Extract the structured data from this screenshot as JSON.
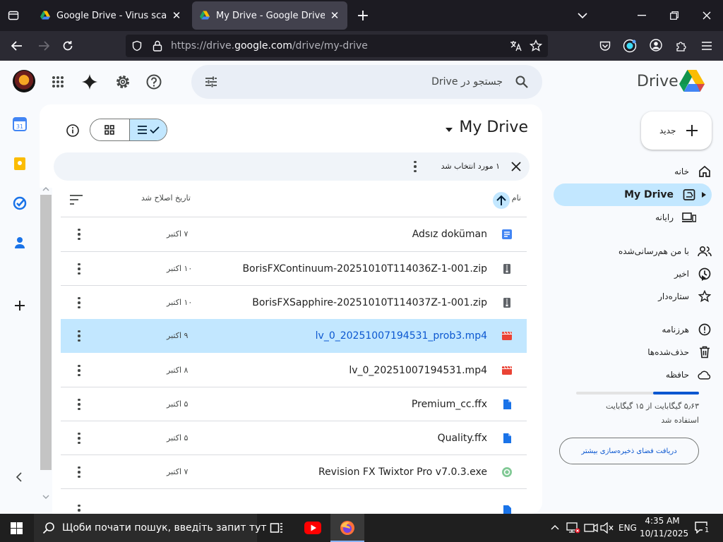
{
  "browser": {
    "tabs": [
      {
        "title": "Google Drive - Virus scan warning",
        "close": "✕"
      },
      {
        "title": "My Drive - Google Drive",
        "close": "✕"
      }
    ],
    "new_tab": "+",
    "url_prefix": "https://drive.",
    "url_domain": "google.com",
    "url_path": "/drive/my-drive"
  },
  "drive": {
    "logo_text": "Drive",
    "search_placeholder": "جستجو در Drive",
    "page_title": "My Drive",
    "selection_text": "۱ مورد انتخاب شد",
    "col_name": "نام",
    "col_modified": "تاریخ اصلاح شد",
    "new_button": "جدید",
    "nav": [
      {
        "label": "خانه",
        "icon": "home-icon"
      },
      {
        "label": "My Drive",
        "icon": "my-drive-icon",
        "active": true
      },
      {
        "label": "رایانه",
        "icon": "computer-icon"
      },
      {
        "label": "با من هم‌رسانی‌شده",
        "icon": "shared-icon"
      },
      {
        "label": "اخیر",
        "icon": "clock-icon"
      },
      {
        "label": "ستاره‌دار",
        "icon": "star-icon"
      },
      {
        "label": "هرزنامه",
        "icon": "spam-icon"
      },
      {
        "label": "حذف‌شده‌ها",
        "icon": "trash-icon"
      },
      {
        "label": "حافظه",
        "icon": "cloud-icon"
      }
    ],
    "storage_text": "۵٫۶۳ گیگابایت از ۱۵ گیگابایت استفاده شد",
    "storage_fraction": 0.375,
    "storage_button": "دریافت فضای ذخیره‌سازی بیشتر",
    "files": [
      {
        "name": "Adsız doküman",
        "date": "۷ اکتبر",
        "icon": "doc"
      },
      {
        "name": "BorisFXContinuum-20251010T114036Z-1-001.zip",
        "date": "۱۰ اکتبر",
        "icon": "zip"
      },
      {
        "name": "BorisFXSapphire-20251010T114037Z-1-001.zip",
        "date": "۱۰ اکتبر",
        "icon": "zip"
      },
      {
        "name": "lv_0_20251007194531_prob3.mp4",
        "date": "۹ اکتبر",
        "icon": "video",
        "selected": true
      },
      {
        "name": "lv_0_20251007194531.mp4",
        "date": "۸ اکتبر",
        "icon": "video"
      },
      {
        "name": "Premium_cc.ffx",
        "date": "۵ اکتبر",
        "icon": "file"
      },
      {
        "name": "Quality.ffx",
        "date": "۵ اکتبر",
        "icon": "file"
      },
      {
        "name": "Revision FX Twixtor Pro v7.0.3.exe",
        "date": "۷ اکتبر",
        "icon": "exe"
      }
    ]
  },
  "taskbar": {
    "search_text": "Щоби почати пошук, введіть запит тут",
    "lang": "ENG",
    "time": "4:35 AM",
    "date": "10/11/2025",
    "notif_count": "1"
  }
}
